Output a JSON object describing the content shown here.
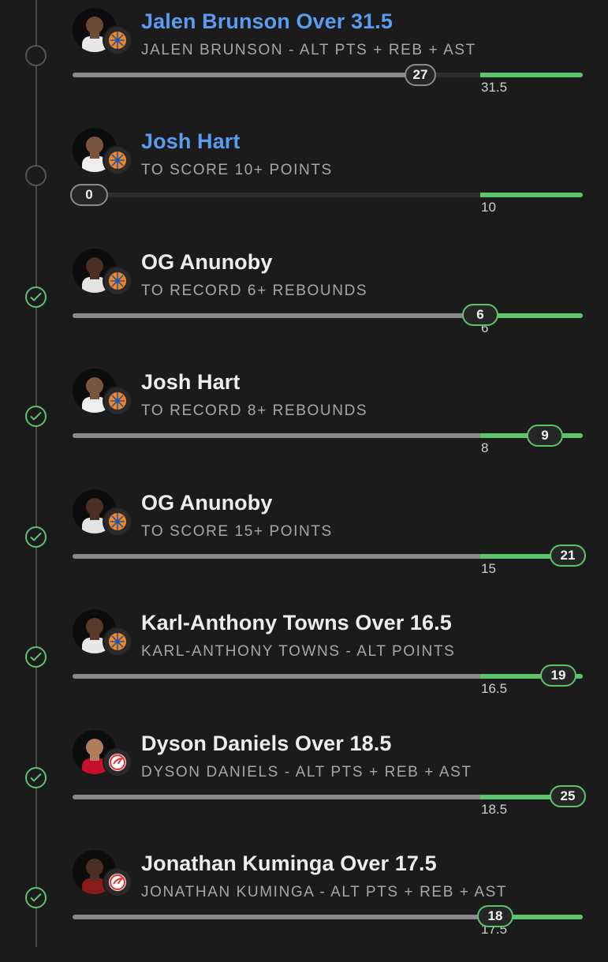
{
  "colors": {
    "background": "#1b1b1b",
    "pending_title": "#5b9bf0",
    "won_accent": "#5cc46b",
    "track_progress": "#8a8a8a"
  },
  "legs": [
    {
      "status": "pending",
      "title": "Jalen Brunson Over 31.5",
      "title_color": "blue",
      "market": "JALEN BRUNSON - ALT PTS + REB + AST",
      "current": "27",
      "current_value": 27,
      "target": "31.5",
      "target_value": 31.5,
      "team": "knicks-logo"
    },
    {
      "status": "pending",
      "title": "Josh Hart",
      "title_color": "blue",
      "market": "TO SCORE 10+ POINTS",
      "current": "0",
      "current_value": 0,
      "target": "10",
      "target_value": 10,
      "team": "knicks-logo"
    },
    {
      "status": "won",
      "title": "OG Anunoby",
      "title_color": "white",
      "market": "TO RECORD 6+ REBOUNDS",
      "current": "6",
      "current_value": 6,
      "target": "6",
      "target_value": 6,
      "team": "knicks-logo"
    },
    {
      "status": "won",
      "title": "Josh Hart",
      "title_color": "white",
      "market": "TO RECORD 8+ REBOUNDS",
      "current": "9",
      "current_value": 9,
      "target": "8",
      "target_value": 8,
      "team": "knicks-logo"
    },
    {
      "status": "won",
      "title": "OG Anunoby",
      "title_color": "white",
      "market": "TO SCORE 15+ POINTS",
      "current": "21",
      "current_value": 21,
      "target": "15",
      "target_value": 15,
      "team": "knicks-logo"
    },
    {
      "status": "won",
      "title": "Karl-Anthony Towns Over 16.5",
      "title_color": "white",
      "market": "KARL-ANTHONY TOWNS - ALT POINTS",
      "current": "19",
      "current_value": 19,
      "target": "16.5",
      "target_value": 16.5,
      "team": "knicks-logo"
    },
    {
      "status": "won",
      "title": "Dyson Daniels Over 18.5",
      "title_color": "white",
      "market": "DYSON DANIELS - ALT PTS + REB + AST",
      "current": "25",
      "current_value": 25,
      "target": "18.5",
      "target_value": 18.5,
      "team": "hawks-logo"
    },
    {
      "status": "won",
      "title": "Jonathan Kuminga Over 17.5",
      "title_color": "white",
      "market": "JONATHAN KUMINGA - ALT PTS + REB + AST",
      "current": "18",
      "current_value": 18,
      "target": "17.5",
      "target_value": 17.5,
      "team": "hawks-logo"
    }
  ]
}
